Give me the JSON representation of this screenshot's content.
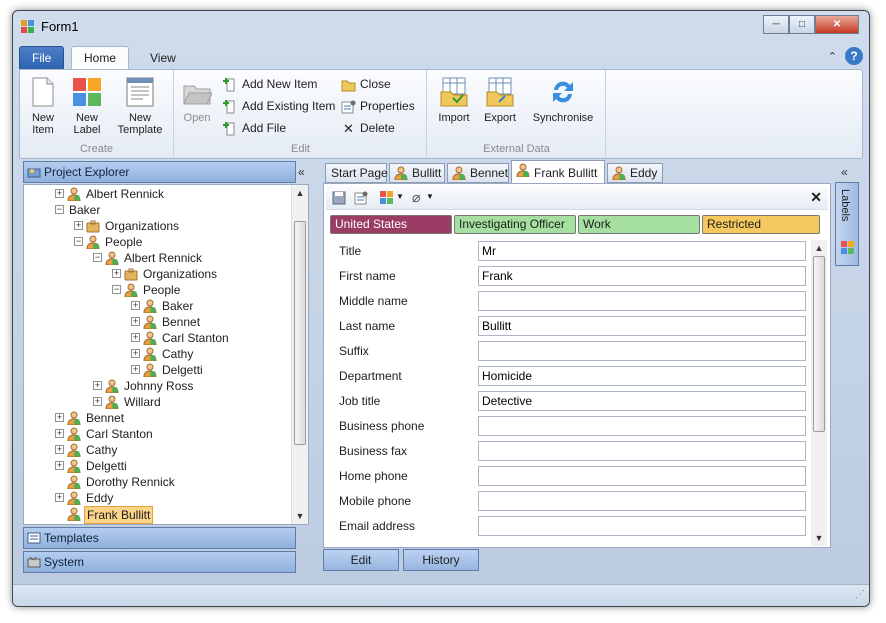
{
  "window": {
    "title": "Form1",
    "minimize": "0",
    "maximize": "1",
    "close": "r"
  },
  "ribbon": {
    "tabs": [
      {
        "label": "File"
      },
      {
        "label": "Home"
      },
      {
        "label": "View"
      }
    ],
    "groups": {
      "create": {
        "label": "Create",
        "new_item": "New\nItem",
        "new_label": "New\nLabel",
        "new_template": "New\nTemplate"
      },
      "edit": {
        "label": "Edit",
        "open": "Open",
        "add_new_item": "Add New Item",
        "add_existing_item": "Add Existing Item",
        "add_file": "Add File",
        "close": "Close",
        "properties": "Properties",
        "delete": "Delete"
      },
      "external": {
        "label": "External Data",
        "import": "Import",
        "export": "Export",
        "synchronise": "Synchronise"
      }
    }
  },
  "left": {
    "project_explorer": "Project Explorer",
    "templates": "Templates",
    "system": "System",
    "collapse": "«",
    "tree": [
      {
        "label": "Albert Rennick",
        "level": 1,
        "icon": "person",
        "exp": "+"
      },
      {
        "label": "Baker",
        "level": 1,
        "icon": "none",
        "exp": "-"
      },
      {
        "label": "Organizations",
        "level": 2,
        "icon": "briefcase",
        "exp": "+"
      },
      {
        "label": "People",
        "level": 2,
        "icon": "person",
        "exp": "-"
      },
      {
        "label": "Albert Rennick",
        "level": 3,
        "icon": "person",
        "exp": "-"
      },
      {
        "label": "Organizations",
        "level": 4,
        "icon": "briefcase",
        "exp": "+"
      },
      {
        "label": "People",
        "level": 4,
        "icon": "person",
        "exp": "-"
      },
      {
        "label": "Baker",
        "level": 5,
        "icon": "person",
        "exp": "+"
      },
      {
        "label": "Bennet",
        "level": 5,
        "icon": "person",
        "exp": "+"
      },
      {
        "label": "Carl Stanton",
        "level": 5,
        "icon": "person",
        "exp": "+"
      },
      {
        "label": "Cathy",
        "level": 5,
        "icon": "person",
        "exp": "+"
      },
      {
        "label": "Delgetti",
        "level": 5,
        "icon": "person",
        "exp": "+"
      },
      {
        "label": "Johnny Ross",
        "level": 3,
        "icon": "person",
        "exp": "+"
      },
      {
        "label": "Willard",
        "level": 3,
        "icon": "person",
        "exp": "+"
      },
      {
        "label": "Bennet",
        "level": 1,
        "icon": "person",
        "exp": "+"
      },
      {
        "label": "Carl Stanton",
        "level": 1,
        "icon": "person",
        "exp": "+"
      },
      {
        "label": "Cathy",
        "level": 1,
        "icon": "person",
        "exp": "+"
      },
      {
        "label": "Delgetti",
        "level": 1,
        "icon": "person",
        "exp": "+"
      },
      {
        "label": "Dorothy Rennick",
        "level": 1,
        "icon": "person",
        "exp": ""
      },
      {
        "label": "Eddy",
        "level": 1,
        "icon": "person",
        "exp": "+"
      },
      {
        "label": "Frank Bullitt",
        "level": 1,
        "icon": "person",
        "exp": "",
        "selected": true
      }
    ]
  },
  "doc_tabs": [
    {
      "label": "Start Page",
      "icon": false
    },
    {
      "label": "Bullitt",
      "icon": true
    },
    {
      "label": "Bennet",
      "icon": true
    },
    {
      "label": "Frank Bullitt",
      "icon": true,
      "active": true
    },
    {
      "label": "Eddy",
      "icon": true
    }
  ],
  "doc": {
    "close": "✕",
    "labels": [
      {
        "label": "United States",
        "color": "#9b3c64",
        "text": "#ffffff"
      },
      {
        "label": "Investigating Officer",
        "color": "#a6e0a0",
        "text": "#1e1e1e"
      },
      {
        "label": "Work",
        "color": "#a6e0a0",
        "text": "#1e1e1e"
      },
      {
        "label": "Restricted",
        "color": "#f5c860",
        "text": "#1e1e1e"
      }
    ],
    "fields": [
      {
        "label": "Title",
        "value": "Mr"
      },
      {
        "label": "First name",
        "value": "Frank"
      },
      {
        "label": "Middle name",
        "value": ""
      },
      {
        "label": "Last name",
        "value": "Bullitt"
      },
      {
        "label": "Suffix",
        "value": ""
      },
      {
        "label": "Department",
        "value": "Homicide"
      },
      {
        "label": "Job title",
        "value": "Detective"
      },
      {
        "label": "Business phone",
        "value": ""
      },
      {
        "label": "Business fax",
        "value": ""
      },
      {
        "label": "Home phone",
        "value": ""
      },
      {
        "label": "Mobile phone",
        "value": ""
      },
      {
        "label": "Email address",
        "value": ""
      }
    ],
    "edit_button": "Edit",
    "history_button": "History"
  },
  "labels_panel": {
    "label": "Labels",
    "collapse": "«"
  }
}
